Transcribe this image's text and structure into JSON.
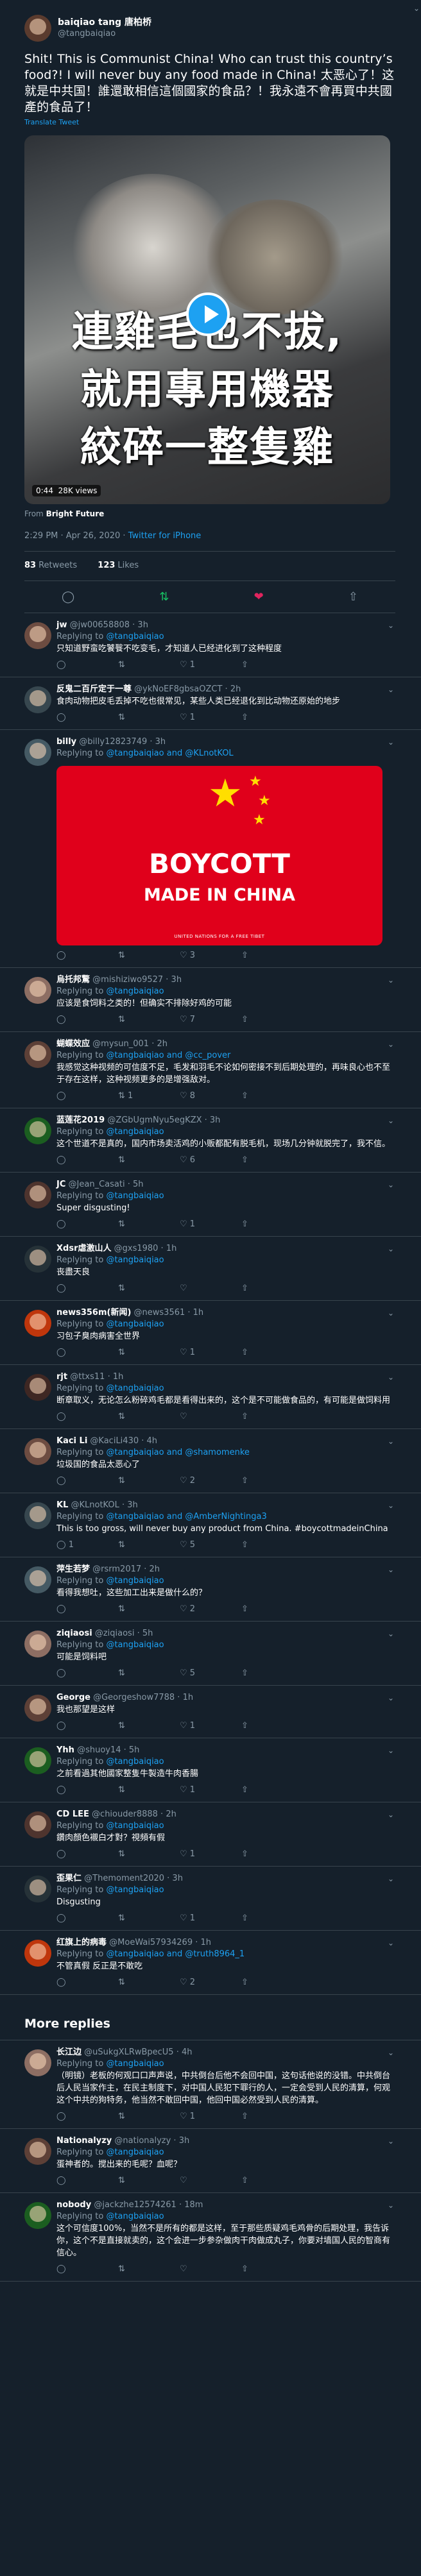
{
  "tweet": {
    "display_name": "baiqiao tang 唐柏桥",
    "handle": "@tangbaiqiao",
    "text": "Shit! This is Communist China! Who can trust this country’s food?! I will never buy any food made in China! 太恶心了！这就是中共国！誰還敢相信這個國家的食品？！我永遠不會再買中共國產的食品了！",
    "translate": "Translate Tweet",
    "video": {
      "caption_line1": "連雞毛也不拔,",
      "caption_line2": "就用專用機器",
      "caption_line3": "絞碎一整隻雞",
      "time": "0:44",
      "views": "28K views"
    },
    "from_prefix": "From",
    "from_source": "Bright Future",
    "timestamp": "2:29 PM · Apr 26, 2020 ·",
    "client": "Twitter for iPhone",
    "retweets_count": "83",
    "retweets_label": "Retweets",
    "likes_count": "123",
    "likes_label": "Likes"
  },
  "replies": [
    {
      "name": "jw",
      "handle": "@jw00658808 · 3h",
      "to": "@tangbaiqiao",
      "text": "只知道野蛮吃饕餮不吃变毛，才知道人已经进化到了这种程度",
      "r": "",
      "rt": "",
      "l": "1"
    },
    {
      "name": "反鬼二百斤定于一尊",
      "handle": "@ykNoEF8gbsaOZCT · 2h",
      "to": "",
      "text": "食肉动物把皮毛丢掉不吃也很常见，某些人类已经退化到比动物还原始的地步",
      "r": "",
      "rt": "",
      "l": "1"
    },
    {
      "name": "billy",
      "handle": "@billy12823749 · 3h",
      "to": "@tangbaiqiao and @KLnotKOL",
      "text": "",
      "r": "",
      "rt": "",
      "l": "3",
      "banner": {
        "line1": "BOYCOTT",
        "line2": "MADE IN CHINA",
        "line3": "UNITED NATIONS FOR A FREE TIBET"
      }
    },
    {
      "name": "烏托邦驚",
      "handle": "@mishiziwo9527 · 3h",
      "to": "@tangbaiqiao",
      "text": "应该是食饲料之类的！但确实不排除好鸡的可能",
      "r": "",
      "rt": "",
      "l": "7"
    },
    {
      "name": "蝴蝶效应",
      "handle": "@mysun_001 · 2h",
      "to": "@tangbaiqiao and @cc_pover",
      "text": "我感觉这种视频的可信度不足，毛发和羽毛不论如何密接不到后期处理的，再味良心也不至于存在这样，这种视频更多的是增强敌对。",
      "r": "",
      "rt": "1",
      "l": "8"
    },
    {
      "name": "蓝莲花2019",
      "handle": "@ZGbUgmNyu5egKZX · 3h",
      "to": "@tangbaiqiao",
      "text": "这个世道不是真的，国内市场卖活鸡的小贩都配有脱毛机，现场几分钟就脱完了，我不信。",
      "r": "",
      "rt": "",
      "l": "6"
    },
    {
      "name": "JC",
      "handle": "@Jean_Casati · 5h",
      "to": "@tangbaiqiao",
      "text": "Super disgusting!",
      "r": "",
      "rt": "",
      "l": "1"
    },
    {
      "name": "Xdsr虐激山人",
      "handle": "@gxs1980 · 1h",
      "to": "@tangbaiqiao",
      "text": "丧盡天良",
      "r": "",
      "rt": "",
      "l": ""
    },
    {
      "name": "news356m(新闻)",
      "handle": "@news3561 · 1h",
      "to": "@tangbaiqiao",
      "text": "习包子臭肉病害全世界",
      "r": "",
      "rt": "",
      "l": "1"
    },
    {
      "name": "rjt",
      "handle": "@ttxs11 · 1h",
      "to": "@tangbaiqiao",
      "text": "断章取义，无论怎么粉碎鸡毛都是看得出来的，这个是不可能做食品的，有可能是做饲料用",
      "r": "",
      "rt": "",
      "l": ""
    },
    {
      "name": "Kaci Li",
      "handle": "@KaciLi430 · 4h",
      "to": "@tangbaiqiao and @shamomenke",
      "text": "垃圾国的食品太恶心了",
      "r": "",
      "rt": "",
      "l": "2"
    },
    {
      "name": "KL",
      "handle": "@KLnotKOL · 3h",
      "to": "@tangbaiqiao and @AmberNightinga3",
      "text": "This is too gross, will never buy any product from China. #boycottmadeinChina",
      "r": "1",
      "rt": "",
      "l": "5"
    },
    {
      "name": "萍生若梦",
      "handle": "@rsrm2017 · 2h",
      "to": "@tangbaiqiao",
      "text": "看得我想吐，这些加工出来是做什么的？",
      "r": "",
      "rt": "",
      "l": "2"
    },
    {
      "name": "ziqiaosi",
      "handle": "@ziqiaosi · 5h",
      "to": "@tangbaiqiao",
      "text": "可能是饲料吧",
      "r": "",
      "rt": "",
      "l": "5"
    },
    {
      "name": "George",
      "handle": "@Georgeshow7788 · 1h",
      "to": "",
      "text": "我也那望是这样",
      "r": "",
      "rt": "",
      "l": "1"
    },
    {
      "name": "Yhh",
      "handle": "@shuoy14 · 5h",
      "to": "@tangbaiqiao",
      "text": "之前看過其他國家整隻牛製造牛肉香腸",
      "r": "",
      "rt": "",
      "l": "1"
    },
    {
      "name": "CD LEE",
      "handle": "@chiouder8888 · 2h",
      "to": "@tangbaiqiao",
      "text": "鑽肉顏色襯白才對？視頻有假",
      "r": "",
      "rt": "",
      "l": "1"
    },
    {
      "name": "歪果仁",
      "handle": "@Themoment2020 · 3h",
      "to": "@tangbaiqiao",
      "text": "Disgusting",
      "r": "",
      "rt": "",
      "l": "1"
    },
    {
      "name": "红旗上的病毒",
      "handle": "@MoeWai57934269 · 1h",
      "to": "@tangbaiqiao and @truth8964_1",
      "text": "不管真假 反正是不敢吃",
      "r": "",
      "rt": "",
      "l": "2"
    }
  ],
  "more_replies_label": "More replies",
  "more": [
    {
      "name": "长江边",
      "handle": "@uSukgXLRwBpecU5 · 4h",
      "to": "@tangbaiqiao",
      "text": "（明镜）老板的何观口口声声说，中共倒台后他不会回中国，这句话他说的没错。中共倒台后人民当家作主，在民主制度下，对中国人民犯下罪行的人，一定会受到人民的清算，何观这个中共的狗特务，他当然不敢回中国，他回中国必然受到人民的清算。",
      "r": "",
      "rt": "",
      "l": "1"
    },
    {
      "name": "Nationalyzy",
      "handle": "@nationalyzy · 3h",
      "to": "@tangbaiqiao",
      "text": "蛋神者的。搅出来的毛呢？血呢？",
      "r": "",
      "rt": "",
      "l": ""
    },
    {
      "name": "nobody",
      "handle": "@jackzhe12574261 · 18m",
      "to": "@tangbaiqiao",
      "text": "这个可信度100%，当然不是所有的都是这样，至于那些质疑鸡毛鸡骨的后期处理，我告诉你，这个不是直接就卖的，这个会进一步参杂做肉干肉做成丸子，你要对墙国人民的智商有信心。",
      "r": "",
      "rt": "",
      "l": ""
    }
  ]
}
